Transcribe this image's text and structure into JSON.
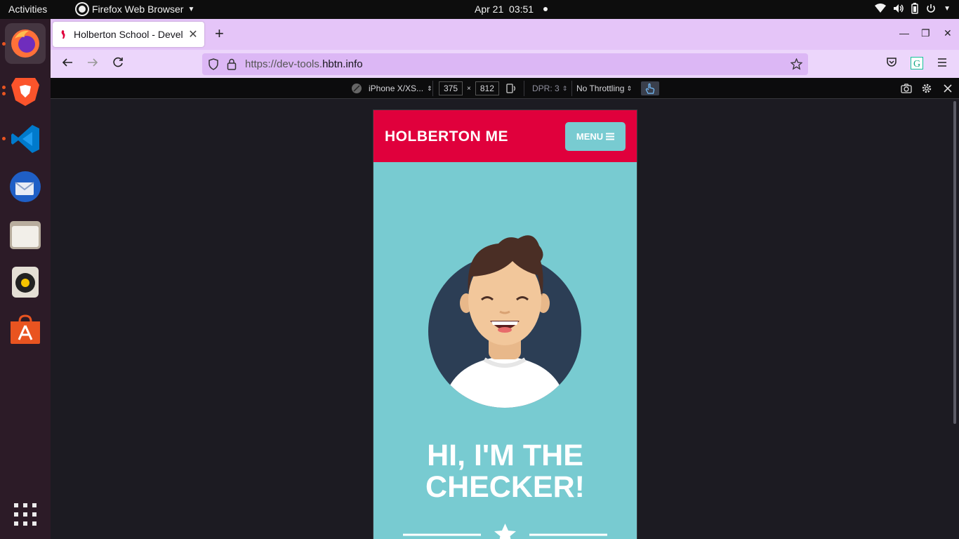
{
  "topbar": {
    "activities": "Activities",
    "app_name": "Firefox Web Browser",
    "date": "Apr 21",
    "time": "03:51"
  },
  "dock": {
    "items": [
      {
        "name": "firefox-icon",
        "running": true,
        "active": true
      },
      {
        "name": "brave-icon",
        "running": true
      },
      {
        "name": "vscode-icon",
        "running": true
      },
      {
        "name": "thunderbird-icon",
        "running": false
      },
      {
        "name": "files-icon",
        "running": false
      },
      {
        "name": "rhythmbox-icon",
        "running": false
      },
      {
        "name": "app-center-icon",
        "running": false
      },
      {
        "name": "show-apps-icon",
        "running": false
      }
    ]
  },
  "browser": {
    "tab_title": "Holberton School - Devel",
    "url_prefix": "https://dev-tools.",
    "url_domain": "hbtn.info"
  },
  "responsive_toolbar": {
    "device": "iPhone X/XS...",
    "width": "375",
    "height": "812",
    "times": "×",
    "dpr": "DPR: 3",
    "throttling": "No Throttling"
  },
  "page": {
    "brand": "HOLBERTON ME",
    "menu_label": "MENU",
    "hero_line1": "HI, I'M THE",
    "hero_line2": "CHECKER!"
  },
  "colors": {
    "header_red": "#e0003c",
    "page_teal": "#78cbd1",
    "tab_bar": "#e5c5f8",
    "nav_bar": "#ecd6fb"
  }
}
